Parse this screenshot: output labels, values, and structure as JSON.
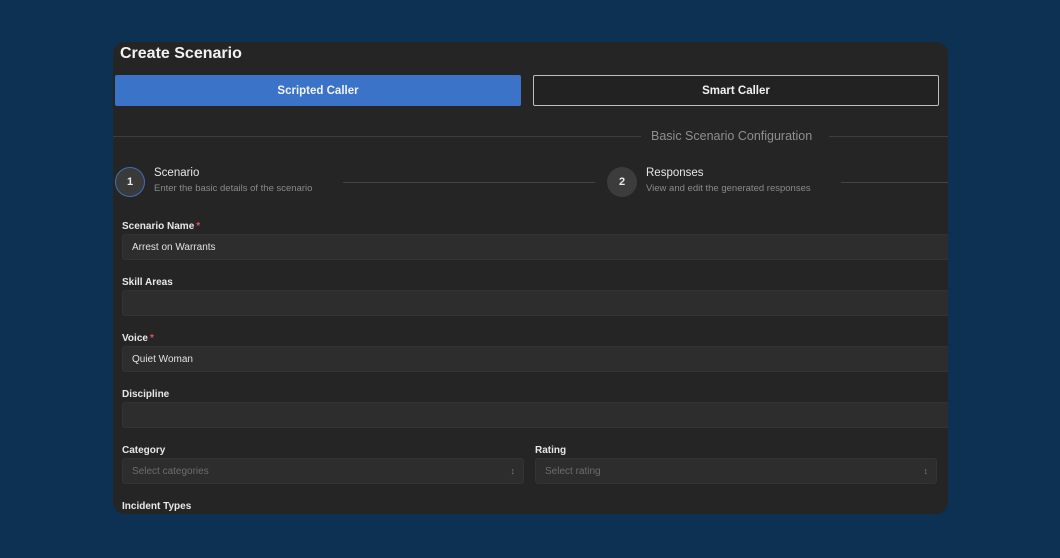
{
  "dialog": {
    "title": "Create Scenario"
  },
  "mode_tabs": {
    "scripted_label": "Scripted Caller",
    "smart_label": "Smart Caller"
  },
  "section": {
    "title": "Basic Scenario Configuration"
  },
  "steps": [
    {
      "number": "1",
      "title": "Scenario",
      "description": "Enter the basic details of the scenario"
    },
    {
      "number": "2",
      "title": "Responses",
      "description": "View and edit the generated responses"
    }
  ],
  "form": {
    "scenario_name": {
      "label": "Scenario Name",
      "required_mark": "*",
      "value": "Arrest on Warrants"
    },
    "skill_areas": {
      "label": "Skill Areas",
      "value": ""
    },
    "voice": {
      "label": "Voice",
      "required_mark": "*",
      "value": "Quiet Woman"
    },
    "discipline": {
      "label": "Discipline",
      "value": ""
    },
    "category": {
      "label": "Category",
      "placeholder": "Select categories"
    },
    "rating": {
      "label": "Rating",
      "placeholder": "Select rating"
    },
    "incident_types": {
      "label": "Incident Types"
    }
  },
  "icons": {
    "select_chevron": "chevron-up-down-icon"
  },
  "colors": {
    "background": "#0d3152",
    "panel": "#252525",
    "accent": "#3a73c7",
    "required": "#e05555"
  }
}
